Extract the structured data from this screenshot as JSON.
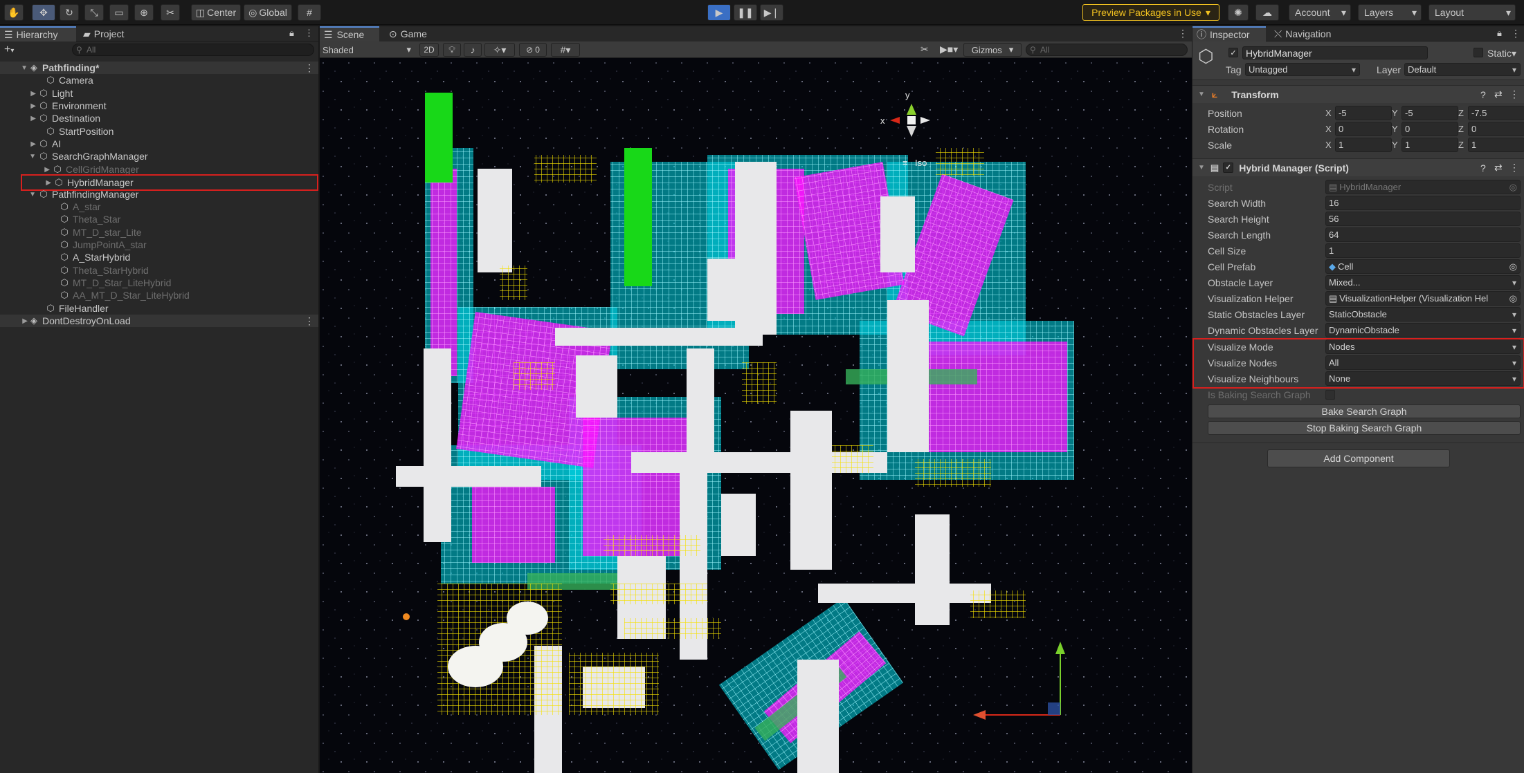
{
  "toolbar": {
    "center_label": "Center",
    "global_label": "Global",
    "preview_packages_label": "Preview Packages in Use",
    "account_label": "Account",
    "layers_label": "Layers",
    "layout_label": "Layout"
  },
  "hierarchy": {
    "tab_hierarchy": "Hierarchy",
    "tab_project": "Project",
    "search_placeholder": "All",
    "add_label": "+",
    "items": [
      {
        "label": "Pathfinding*"
      },
      {
        "label": "Camera"
      },
      {
        "label": "Light"
      },
      {
        "label": "Environment"
      },
      {
        "label": "Destination"
      },
      {
        "label": "StartPosition"
      },
      {
        "label": "AI"
      },
      {
        "label": "SearchGraphManager"
      },
      {
        "label": "CellGridManager"
      },
      {
        "label": "HybridManager"
      },
      {
        "label": "PathfindingManager"
      },
      {
        "label": "A_star"
      },
      {
        "label": "Theta_Star"
      },
      {
        "label": "MT_D_star_Lite"
      },
      {
        "label": "JumpPointA_star"
      },
      {
        "label": "A_StarHybrid"
      },
      {
        "label": "Theta_StarHybrid"
      },
      {
        "label": "MT_D_Star_LiteHybrid"
      },
      {
        "label": "AA_MT_D_Star_LiteHybrid"
      },
      {
        "label": "FileHandler"
      },
      {
        "label": "DontDestroyOnLoad"
      }
    ]
  },
  "scene": {
    "tab_scene": "Scene",
    "tab_game": "Game",
    "shading_mode": "Shaded",
    "mode_2d": "2D",
    "hidden_count": "0",
    "gizmos_label": "Gizmos",
    "search_placeholder": "All",
    "gizmo_x": "x",
    "gizmo_y": "y",
    "projection_label": "Iso"
  },
  "inspector": {
    "tab_inspector": "Inspector",
    "tab_navigation": "Navigation",
    "object_name": "HybridManager",
    "static_label": "Static",
    "tag_label": "Tag",
    "tag_value": "Untagged",
    "layer_label": "Layer",
    "layer_value": "Default",
    "transform": {
      "title": "Transform",
      "position_label": "Position",
      "rotation_label": "Rotation",
      "scale_label": "Scale",
      "position": {
        "x": "-5",
        "y": "-5",
        "z": "-7.5"
      },
      "rotation": {
        "x": "0",
        "y": "0",
        "z": "0"
      },
      "scale": {
        "x": "1",
        "y": "1",
        "z": "1"
      }
    },
    "script_component": {
      "title": "Hybrid Manager (Script)",
      "script_label": "Script",
      "script_value": "HybridManager",
      "fields": [
        {
          "label": "Search Width",
          "value": "16"
        },
        {
          "label": "Search Height",
          "value": "56"
        },
        {
          "label": "Search Length",
          "value": "64"
        },
        {
          "label": "Cell Size",
          "value": "1"
        },
        {
          "label": "Cell Prefab",
          "value": "Cell"
        },
        {
          "label": "Obstacle Layer",
          "value": "Mixed..."
        },
        {
          "label": "Visualization Helper",
          "value": "VisualizationHelper (Visualization Hel"
        },
        {
          "label": "Static Obstacles Layer",
          "value": "StaticObstacle"
        },
        {
          "label": "Dynamic Obstacles Layer",
          "value": "DynamicObstacle"
        },
        {
          "label": "Visualize Mode",
          "value": "Nodes"
        },
        {
          "label": "Visualize Nodes",
          "value": "All"
        },
        {
          "label": "Visualize Neighbours",
          "value": "None"
        },
        {
          "label": "Is Baking Search Graph",
          "value": ""
        }
      ],
      "bake_button": "Bake Search Graph",
      "stop_bake_button": "Stop Baking Search Graph"
    },
    "add_component_button": "Add Component"
  },
  "colors": {
    "accent_blue": "#5a8dd8",
    "highlight_red": "#d8201e",
    "preview_yellow": "#f0c020",
    "cyan_nodes": "#00e8f0",
    "magenta_nodes": "#ff00ff",
    "yellow_nodes": "#f4e000"
  }
}
